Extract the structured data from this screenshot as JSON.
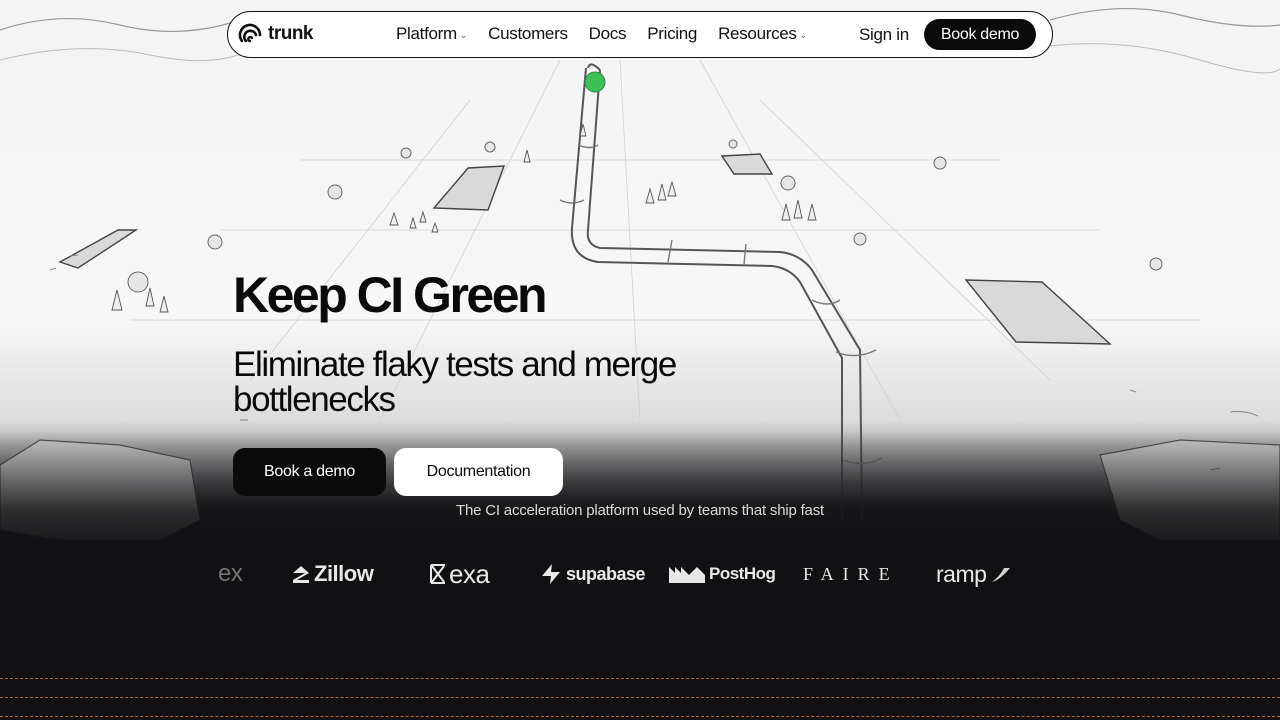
{
  "nav": {
    "logo_text": "trunk",
    "links": [
      {
        "label": "Platform",
        "dropdown": true
      },
      {
        "label": "Customers",
        "dropdown": false
      },
      {
        "label": "Docs",
        "dropdown": false
      },
      {
        "label": "Pricing",
        "dropdown": false
      },
      {
        "label": "Resources",
        "dropdown": true
      }
    ],
    "signin_label": "Sign in",
    "cta_label": "Book demo"
  },
  "hero": {
    "title": "Keep CI Green",
    "subtitle": "Eliminate flaky tests and merge bottlenecks",
    "primary_button": "Book a demo",
    "secondary_button": "Documentation",
    "tagline": "The CI acceleration platform used by teams that ship fast"
  },
  "customer_logos": [
    "ex",
    "Zillow",
    "exa",
    "supabase",
    "PostHog",
    "FAIRE",
    "ramp"
  ],
  "colors": {
    "accent_green": "#3fbf5a",
    "dark": "#0b0b0b",
    "dash_orange": "#b86a2a"
  }
}
